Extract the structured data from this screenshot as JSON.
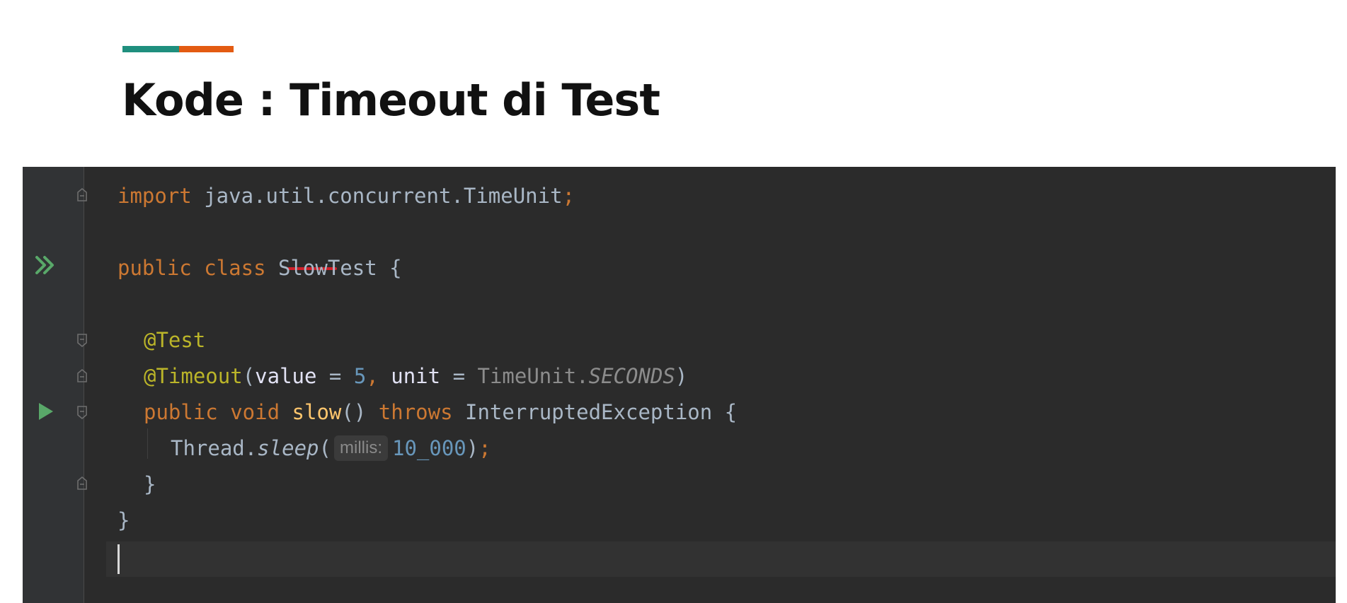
{
  "slide": {
    "title": "Kode : Timeout di Test",
    "accent_colors": [
      "#1f8f7e",
      "#e35b12"
    ]
  },
  "editor": {
    "theme": {
      "background": "#2b2b2b",
      "gutter": "#313335",
      "keyword": "#cc7832",
      "annotation": "#bbb529",
      "method": "#ffc66d",
      "number": "#6897bb",
      "text": "#a9b7c6"
    },
    "lines": {
      "l1": {
        "kw_import": "import",
        "path": " java.util.concurrent.TimeUnit",
        "semi": ";"
      },
      "l3": {
        "kw_public": "public",
        "kw_class": " class",
        "name": " SlowTest {"
      },
      "l5": {
        "ann_test": "@Test"
      },
      "l6": {
        "ann_timeout": "@Timeout",
        "open": "(",
        "p_value": "value",
        "eq1": " = ",
        "n5": "5",
        "comma": ",",
        "p_unit": " unit",
        "eq2": " = ",
        "cls": "TimeUnit.",
        "const": "SECONDS",
        "close": ")"
      },
      "l7": {
        "kw_public": "public",
        "kw_void": " void",
        "method": " slow",
        "parens": "() ",
        "kw_throws": "throws",
        "exc": " InterruptedException {"
      },
      "l8": {
        "cls": "Thread.",
        "method": "sleep",
        "open": "(",
        "hint": "millis:",
        "num": "10_000",
        "close": ")",
        "semi": ";"
      },
      "l9": {
        "brace": "}"
      },
      "l10": {
        "brace": "}"
      }
    },
    "gutter_icons": {
      "run_class": "run-all-tests-icon",
      "run_method": "run-test-icon",
      "fold": "fold-marker-icon"
    }
  }
}
